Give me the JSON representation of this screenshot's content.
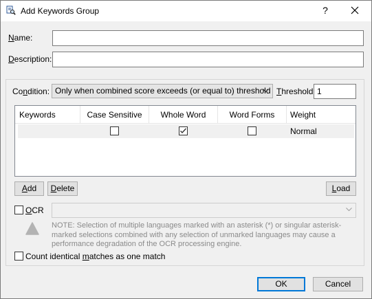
{
  "window": {
    "title": "Add Keywords Group",
    "help_glyph": "?",
    "icon": "magnifier-document-icon"
  },
  "name_field": {
    "label_prefix": "",
    "label_accel": "N",
    "label_rest": "ame:",
    "value": ""
  },
  "description_field": {
    "label_accel": "D",
    "label_rest": "escription:",
    "value": ""
  },
  "condition": {
    "label_pre": "Co",
    "label_accel": "n",
    "label_rest": "dition:",
    "selected": "Only when combined score exceeds (or equal to) threshold"
  },
  "threshold": {
    "label_accel": "T",
    "label_rest": "hreshold:",
    "value": "1"
  },
  "keywords_table": {
    "columns": [
      "Keywords",
      "Case Sensitive",
      "Whole Word",
      "Word Forms",
      "Weight"
    ],
    "rows": [
      {
        "keyword": "",
        "case_sensitive": false,
        "whole_word": true,
        "word_forms": false,
        "weight": "Normal"
      }
    ]
  },
  "buttons": {
    "add_accel": "A",
    "add_rest": "dd",
    "delete_accel": "D",
    "delete_rest": "elete",
    "load_accel": "L",
    "load_rest": "oad",
    "ok": "OK",
    "cancel": "Cancel"
  },
  "ocr": {
    "label_accel": "O",
    "label_rest": "CR",
    "checked": false,
    "language_value": "",
    "note": "NOTE: Selection of multiple languages marked with an asterisk (*) or singular asterisk-marked selections combined with any selection of unmarked languages may cause a performance degradation of the OCR processing engine."
  },
  "count_identical": {
    "label_pre": "Count identical ",
    "label_accel": "m",
    "label_rest": "atches as one match",
    "checked": false
  },
  "colors": {
    "accent": "#0078d7",
    "check": "#333333"
  }
}
